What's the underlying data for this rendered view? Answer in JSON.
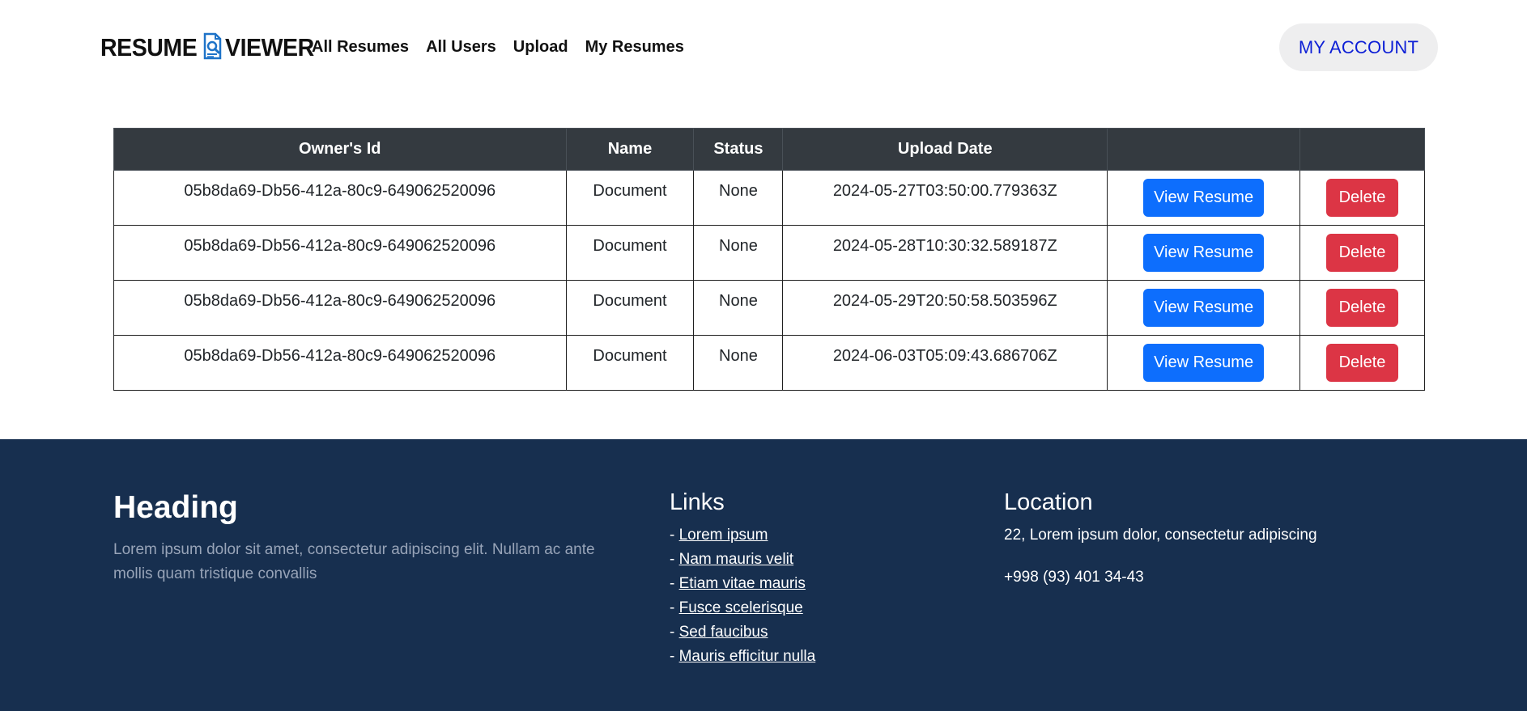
{
  "header": {
    "logo_left": "RESUME",
    "logo_right": "VIEWER",
    "logo_icon": "resume-magnifier-icon",
    "nav": [
      "All Resumes",
      "All Users",
      "Upload",
      "My Resumes"
    ],
    "account_label": "MY ACCOUNT"
  },
  "table": {
    "columns": [
      "Owner's Id",
      "Name",
      "Status",
      "Upload Date",
      "",
      ""
    ],
    "rows": [
      {
        "owner_id": "05b8da69-Db56-412a-80c9-649062520096",
        "name": "Document",
        "status": "None",
        "upload_date": "2024-05-27T03:50:00.779363Z",
        "view_label": "View Resume",
        "delete_label": "Delete"
      },
      {
        "owner_id": "05b8da69-Db56-412a-80c9-649062520096",
        "name": "Document",
        "status": "None",
        "upload_date": "2024-05-28T10:30:32.589187Z",
        "view_label": "View Resume",
        "delete_label": "Delete"
      },
      {
        "owner_id": "05b8da69-Db56-412a-80c9-649062520096",
        "name": "Document",
        "status": "None",
        "upload_date": "2024-05-29T20:50:58.503596Z",
        "view_label": "View Resume",
        "delete_label": "Delete"
      },
      {
        "owner_id": "05b8da69-Db56-412a-80c9-649062520096",
        "name": "Document",
        "status": "None",
        "upload_date": "2024-06-03T05:09:43.686706Z",
        "view_label": "View Resume",
        "delete_label": "Delete"
      }
    ]
  },
  "footer": {
    "heading": "Heading",
    "description": "Lorem ipsum dolor sit amet, consectetur adipiscing elit. Nullam ac ante mollis quam tristique convallis",
    "links_title": "Links",
    "link_prefix": "- ",
    "links": [
      "Lorem ipsum",
      "Nam mauris velit",
      "Etiam vitae mauris",
      "Fusce scelerisque",
      "Sed faucibus",
      "Mauris efficitur nulla"
    ],
    "location_title": "Location",
    "address": "22, Lorem ipsum dolor, consectetur adipiscing",
    "phone": "+998 (93) 401 34-43"
  },
  "colors": {
    "table_header_bg": "#343a40",
    "view_button": "#0d6efd",
    "delete_button": "#dc3545",
    "footer_bg": "#172f4f",
    "account_text": "#0d1fd6"
  }
}
